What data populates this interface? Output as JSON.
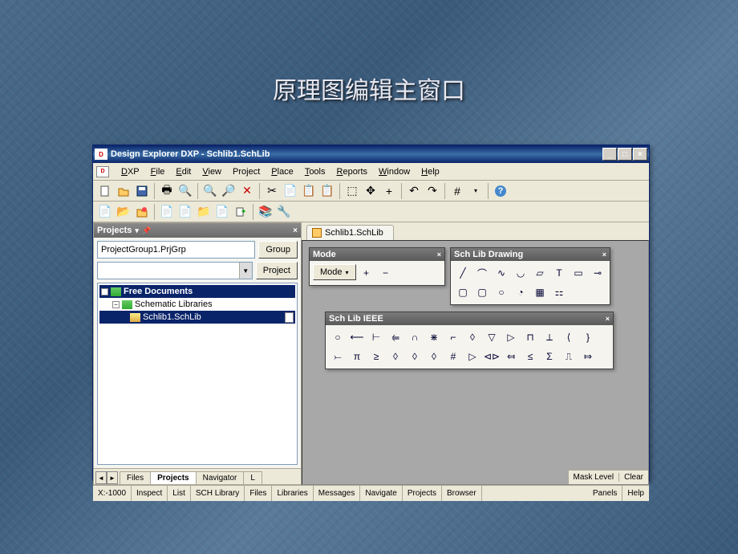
{
  "slide_title": "原理图编辑主窗口",
  "title": "Design Explorer DXP - Schlib1.SchLib",
  "logo_text": "D|XP",
  "menu": {
    "dxp": "DXP",
    "file": "File",
    "edit": "Edit",
    "view": "View",
    "project": "Project",
    "place": "Place",
    "tools": "Tools",
    "reports": "Reports",
    "window": "Window",
    "help": "Help"
  },
  "projects": {
    "header": "Projects",
    "group_value": "ProjectGroup1.PrjGrp",
    "group_btn": "Group",
    "project_btn": "Project",
    "tree": {
      "root": "Free Documents",
      "child": "Schematic Libraries",
      "leaf": "Schlib1.SchLib"
    },
    "tabs": [
      "Files",
      "Projects",
      "Navigator",
      "L"
    ]
  },
  "doc_tab": "Schlib1.SchLib",
  "mode_panel": {
    "title": "Mode",
    "label": "Mode"
  },
  "drawing_panel": {
    "title": "Sch Lib Drawing"
  },
  "ieee_panel": {
    "title": "Sch Lib IEEE"
  },
  "status": {
    "coord": "X:-1000",
    "tabs": [
      "Inspect",
      "List",
      "SCH Library",
      "Files",
      "Libraries",
      "Messages",
      "Navigate",
      "Projects",
      "Browser",
      "Panels",
      "Help"
    ],
    "right": [
      "Mask Level",
      "Clear"
    ]
  }
}
